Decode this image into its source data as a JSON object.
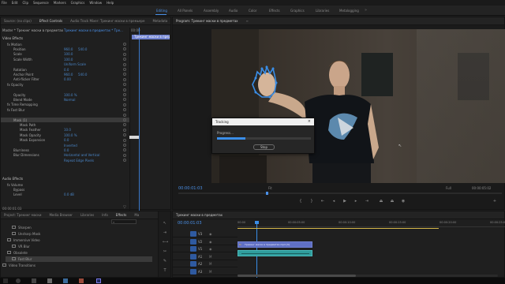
{
  "menu": [
    "File",
    "Edit",
    "Clip",
    "Sequence",
    "Markers",
    "Graphics",
    "Window",
    "Help"
  ],
  "workspaces": [
    {
      "label": "Editing",
      "active": true
    },
    {
      "label": "All Panels",
      "active": false
    },
    {
      "label": "Assembly",
      "active": false
    },
    {
      "label": "Audio",
      "active": false
    },
    {
      "label": "Color",
      "active": false
    },
    {
      "label": "Effects",
      "active": false
    },
    {
      "label": "Graphics",
      "active": false
    },
    {
      "label": "Libraries",
      "active": false
    },
    {
      "label": "Metalogging",
      "active": false
    }
  ],
  "source_tabs": [
    "Source: (no clips)",
    "Effect Controls",
    "Audio Track Mixer: Трекинг маски в премьере",
    "Metadata"
  ],
  "effect_controls": {
    "header_master": "Master * Трекинг маски в предметах",
    "header_clip": "Трекинг маски в предметах * Тре...",
    "header_time": "00:00",
    "clip_bar": "Трекинг маски в предме",
    "section_video": "Video Effects",
    "rows": [
      {
        "label": "fx Motion",
        "indent": 8,
        "value": "",
        "value2": ""
      },
      {
        "label": "Position",
        "indent": 16,
        "value": "960.0",
        "value2": "540.0"
      },
      {
        "label": "Scale",
        "indent": 16,
        "value": "100.0",
        "value2": ""
      },
      {
        "label": "Scale Width",
        "indent": 16,
        "value": "100.0",
        "value2": ""
      },
      {
        "label": "",
        "indent": 16,
        "value": "Uniform Scale",
        "value2": ""
      },
      {
        "label": "Rotation",
        "indent": 16,
        "value": "0.0",
        "value2": ""
      },
      {
        "label": "Anchor Point",
        "indent": 16,
        "value": "960.0",
        "value2": "540.0"
      },
      {
        "label": "Anti-flicker Filter",
        "indent": 16,
        "value": "0.00",
        "value2": ""
      },
      {
        "label": "fx Opacity",
        "indent": 8,
        "value": "",
        "value2": ""
      },
      {
        "label": "",
        "indent": 16,
        "value": "",
        "value2": ""
      },
      {
        "label": "Opacity",
        "indent": 16,
        "value": "100.0 %",
        "value2": ""
      },
      {
        "label": "Blend Mode",
        "indent": 16,
        "value": "Normal",
        "value2": ""
      },
      {
        "label": "fx Time Remapping",
        "indent": 8,
        "value": "",
        "value2": ""
      },
      {
        "label": "fx Fast Blur",
        "indent": 8,
        "value": "",
        "value2": ""
      },
      {
        "label": "",
        "indent": 16,
        "value": "",
        "value2": ""
      },
      {
        "label": "Mask (1)",
        "indent": 16,
        "value": "",
        "value2": ""
      },
      {
        "label": "Mask Path",
        "indent": 24,
        "value": "",
        "value2": ""
      },
      {
        "label": "Mask Feather",
        "indent": 24,
        "value": "10.0",
        "value2": ""
      },
      {
        "label": "Mask Opacity",
        "indent": 24,
        "value": "100.0 %",
        "value2": ""
      },
      {
        "label": "Mask Expansion",
        "indent": 24,
        "value": "0.0",
        "value2": ""
      },
      {
        "label": "",
        "indent": 24,
        "value": "Inverted",
        "value2": ""
      },
      {
        "label": "Blurriness",
        "indent": 16,
        "value": "0.0",
        "value2": ""
      },
      {
        "label": "Blur Dimensions",
        "indent": 16,
        "value": "Horizontal and Vertical",
        "value2": ""
      },
      {
        "label": "",
        "indent": 16,
        "value": "Repeat Edge Pixels",
        "value2": ""
      }
    ],
    "section_audio": "Audio Effects",
    "audio_rows": [
      {
        "label": "fx Volume",
        "indent": 8,
        "value": ""
      },
      {
        "label": "Bypass",
        "indent": 16,
        "value": ""
      },
      {
        "label": "Level",
        "indent": 16,
        "value": "0.0 dB"
      }
    ],
    "timecode": "00:00:01:03"
  },
  "program": {
    "tab": "Program: Трекинг маски в предметах",
    "timecode_left": "00:00:01:03",
    "fit": "Fit",
    "quality": "Full",
    "timecode_right": "00:00:05:02"
  },
  "tracking_dialog": {
    "title": "Tracking",
    "status": "Progress...",
    "progress": 0.3,
    "stop_label": "Stop",
    "close": "×"
  },
  "project": {
    "tabs": [
      "Project: Трекинг маски",
      "Media Browser",
      "Libraries",
      "Info",
      "Effects",
      "Ma"
    ],
    "items": [
      {
        "label": "Sharpen",
        "indent": 0
      },
      {
        "label": "Unsharp Mask",
        "indent": 0
      },
      {
        "label": "Immersive Video",
        "indent": -6
      },
      {
        "label": "VR Blur",
        "indent": 0
      },
      {
        "label": "Obsolete",
        "indent": -6
      },
      {
        "label": "Fast Blur",
        "indent": 0
      },
      {
        "label": "Video Transitions",
        "indent": -12
      }
    ]
  },
  "timeline": {
    "tab": "Трекинг маски в предметах",
    "timecode": "00:00:01:03",
    "ruler": [
      "00:00",
      "00:00:05:00",
      "00:00:10:00",
      "00:00:15:00",
      "00:00:20:00",
      "00:00:25:00"
    ],
    "tracks": [
      {
        "name": "V3"
      },
      {
        "name": "V2"
      },
      {
        "name": "V1"
      },
      {
        "name": "A1"
      },
      {
        "name": "A2"
      },
      {
        "name": "A3"
      }
    ],
    "video_clip": "Трекинг маски в предметах.mp4 [V]",
    "fx_badge": "fx"
  },
  "colors": {
    "accent": "#4a90e8",
    "clip_video": "#6070c4",
    "clip_audio": "#2f9d9d",
    "mask_path": "#3a8ee8"
  }
}
